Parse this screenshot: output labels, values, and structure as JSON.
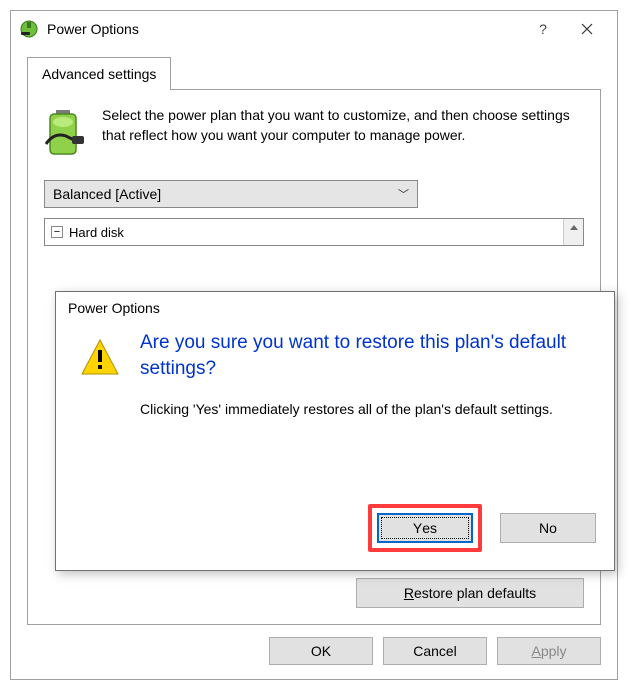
{
  "window": {
    "title": "Power Options"
  },
  "tab": {
    "label": "Advanced settings"
  },
  "intro": "Select the power plan that you want to customize, and then choose settings that reflect how you want your computer to manage power.",
  "plan_selected": "Balanced [Active]",
  "tree_root": "Hard disk",
  "restore_label": "Restore plan defaults",
  "buttons": {
    "ok": "OK",
    "cancel": "Cancel",
    "apply": "Apply"
  },
  "dialog": {
    "title": "Power Options",
    "heading": "Are you sure you want to restore this plan's default settings?",
    "body": "Clicking 'Yes' immediately restores all of the plan's default settings.",
    "yes": "Yes",
    "no": "No"
  }
}
